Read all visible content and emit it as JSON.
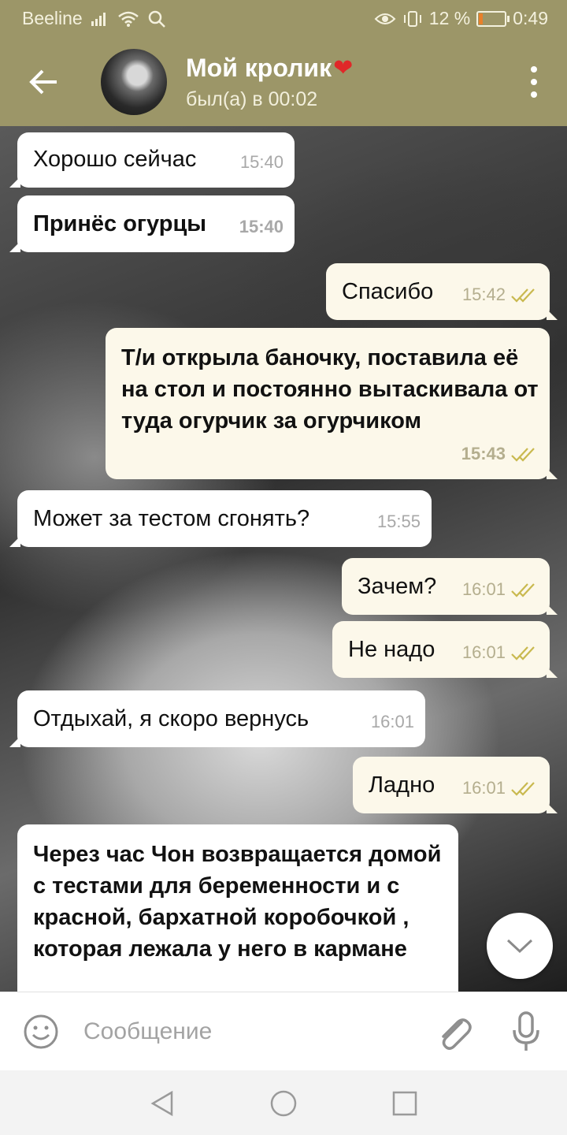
{
  "status_bar": {
    "carrier": "Beeline",
    "battery": "12 %",
    "time": "0:49",
    "battery_level": 0.12
  },
  "header": {
    "contact_name": "Мой кролик",
    "heart": "❤",
    "last_seen": "был(а) в 00:02"
  },
  "messages": [
    {
      "direction": "in",
      "text": "Хорошо сейчас",
      "time": "15:40",
      "bold": false
    },
    {
      "direction": "in",
      "text": "Принёс огурцы",
      "time": "15:40",
      "bold": true
    },
    {
      "direction": "out",
      "text": "Спасибо",
      "time": "15:42",
      "bold": false,
      "read": true
    },
    {
      "direction": "out",
      "text": "Т/и открыла баночку, поставила её на стол и постоянно вытаскивала от туда огурчик за огурчиком",
      "time": "15:43",
      "bold": true,
      "read": true
    },
    {
      "direction": "in",
      "text": "Может за тестом сгонять?",
      "time": "15:55",
      "bold": false
    },
    {
      "direction": "out",
      "text": "Зачем?",
      "time": "16:01",
      "bold": false,
      "read": true
    },
    {
      "direction": "out",
      "text": "Не надо",
      "time": "16:01",
      "bold": false,
      "read": true
    },
    {
      "direction": "in",
      "text": "Отдыхай, я скоро вернусь",
      "time": "16:01",
      "bold": false
    },
    {
      "direction": "out",
      "text": "Ладно",
      "time": "16:01",
      "bold": false,
      "read": true
    },
    {
      "direction": "in",
      "text": "Через час Чон возвращается домой с тестами для беременности и с красной, бархатной коробочкой , которая лежала у него в кармане",
      "time": "",
      "bold": true
    }
  ],
  "composer": {
    "placeholder": "Сообщение"
  },
  "colors": {
    "header_bg": "#9c9668",
    "incoming_bubble": "#ffffff",
    "outgoing_bubble": "#fcf8ea",
    "check_marks": "#c9b94f"
  }
}
